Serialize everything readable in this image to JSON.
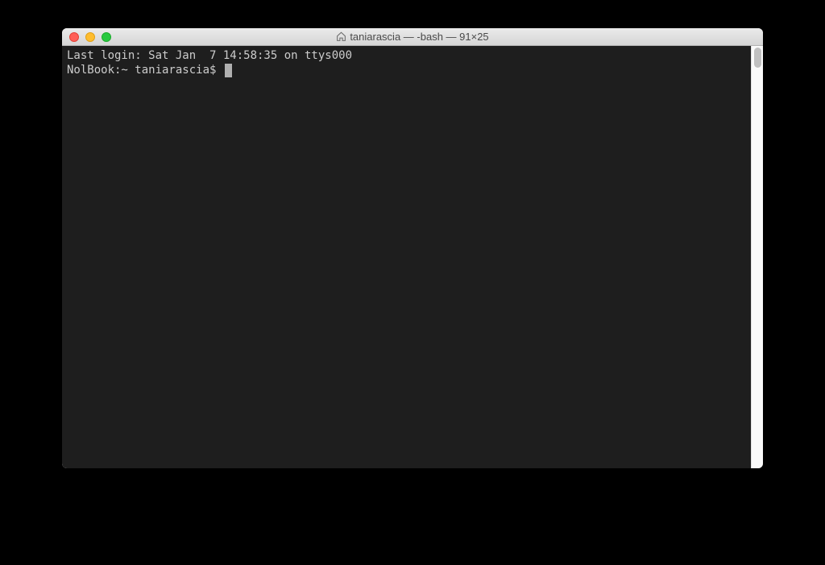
{
  "window": {
    "title": "taniarascia — -bash — 91×25"
  },
  "terminal": {
    "last_login": "Last login: Sat Jan  7 14:58:35 on ttys000",
    "prompt": "NolBook:~ taniarascia$ "
  }
}
